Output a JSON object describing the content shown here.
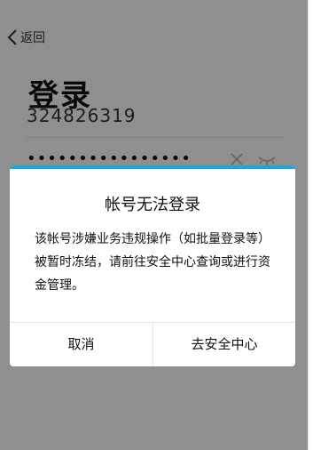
{
  "header": {
    "back_label": "返回"
  },
  "login": {
    "title": "登录",
    "account_value": "324826319",
    "password_dots": "••••••••••••••••"
  },
  "dialog": {
    "title": "帐号无法登录",
    "message": "该帐号涉嫌业务违规操作（如批量登录等）被暂时冻结，请前往安全中心查询或进行资金管理。",
    "cancel_label": "取消",
    "confirm_label": "去安全中心",
    "accent_color": "#17a7e8"
  }
}
